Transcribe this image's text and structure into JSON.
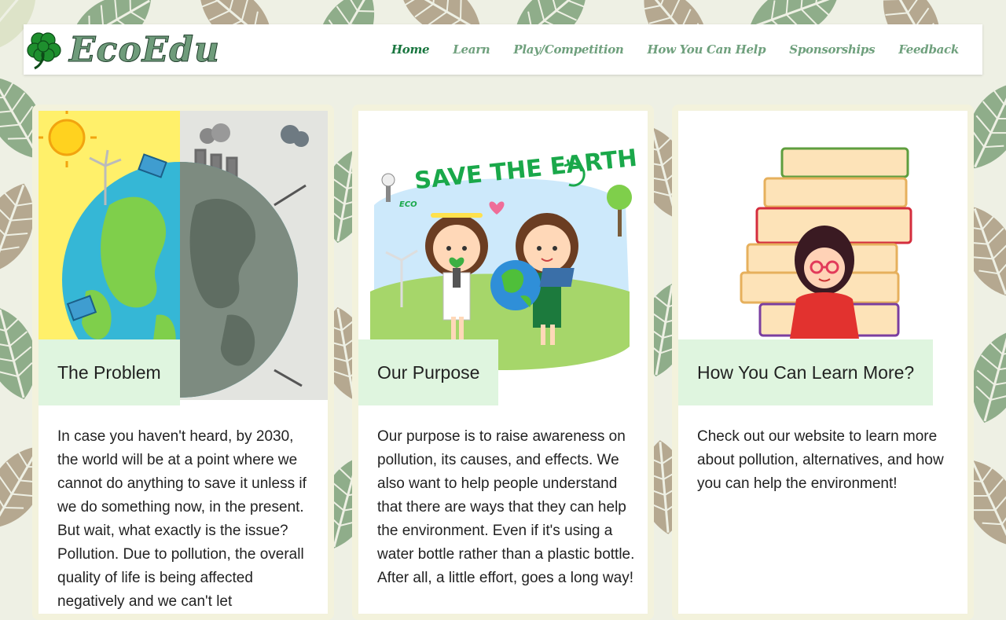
{
  "brand": {
    "name": "EcoEdu",
    "logo_icon": "shamrock-icon"
  },
  "nav": {
    "items": [
      "Home",
      "Learn",
      "Play/Competition",
      "How You Can Help",
      "Sponsorships",
      "Feedback"
    ],
    "active": "Home"
  },
  "cards": [
    {
      "title": "The Problem",
      "body": "In case you haven't heard, by 2030, the world will be at a point where we cannot do anything to save it unless if we do something now, in the present. But wait, what exactly is the issue? Pollution. Due to pollution, the overall quality of life is being affected negatively and we can't let",
      "image": "earth-clean-vs-polluted-illustration"
    },
    {
      "title": "Our Purpose",
      "body": "Our purpose is to raise awareness on pollution, its causes, and effects. We also want to help people understand that there are ways that they can help the environment. Even if it's using a water bottle rather than a plastic bottle. After all, a little effort, goes a long way!",
      "image": "save-the-earth-kids-illustration",
      "image_text": [
        "SAVE THE EARTH",
        "ECO"
      ]
    },
    {
      "title": "How You Can Learn More?",
      "body": "Check out our website to learn more about pollution, alternatives, and how you can help the environment!",
      "image": "teacher-with-books-illustration"
    }
  ],
  "colors": {
    "nav_active": "#19763f",
    "nav_link": "#6fa07d",
    "card_title_bg": "#dff5df",
    "card_border": "#f3f2dc"
  }
}
